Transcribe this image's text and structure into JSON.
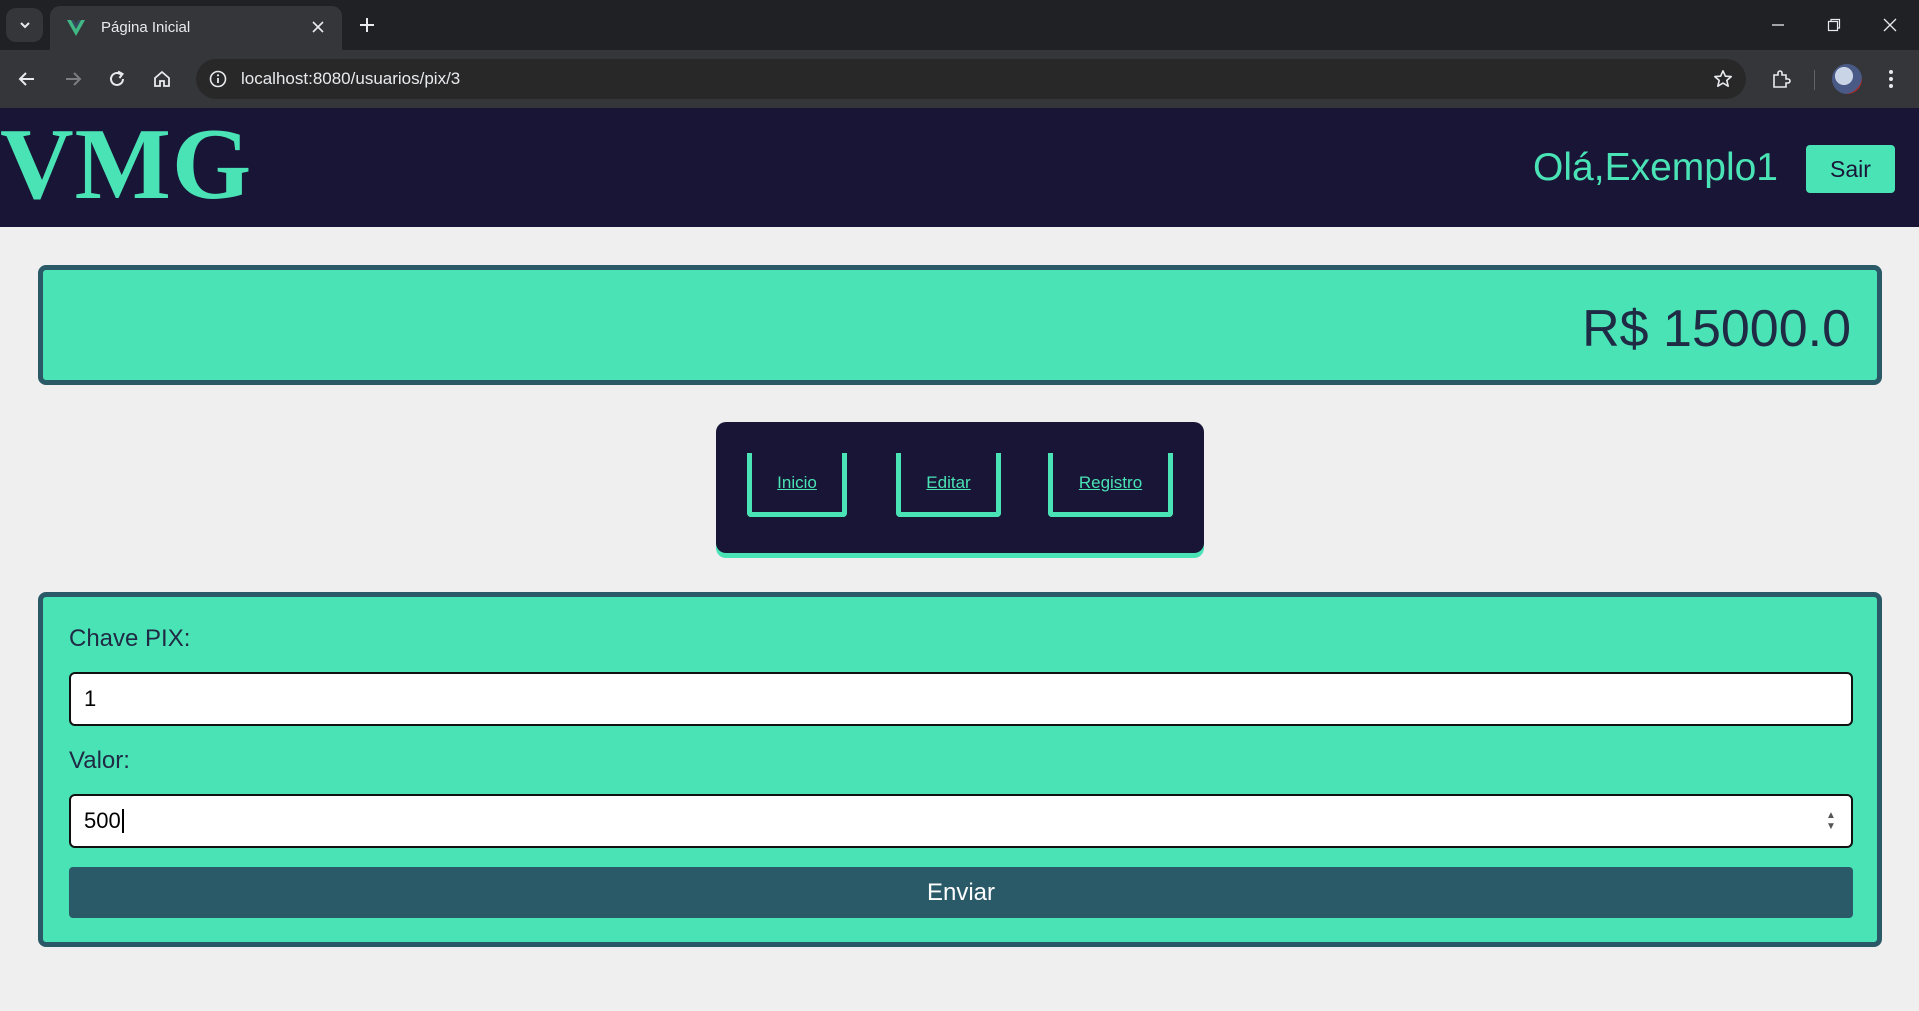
{
  "browser": {
    "tab_title": "Página Inicial",
    "url": "localhost:8080/usuarios/pix/3"
  },
  "header": {
    "logo": "VMG",
    "greeting": "Olá,Exemplo1",
    "logout_label": "Sair"
  },
  "balance": {
    "value": "R$ 15000.0"
  },
  "nav": {
    "links": [
      {
        "label": "Inicio"
      },
      {
        "label": "Editar"
      },
      {
        "label": "Registro"
      }
    ]
  },
  "form": {
    "pix_key_label": "Chave PIX:",
    "pix_key_value": "1",
    "amount_label": "Valor:",
    "amount_value": "500",
    "submit_label": "Enviar"
  },
  "colors": {
    "accent": "#4ae3b5",
    "dark_navy": "#181537",
    "teal_dark": "#2a5a67",
    "page_bg": "#efefef"
  },
  "icons": [
    "tab-search-icon",
    "vue-favicon-icon",
    "close-icon",
    "plus-icon",
    "minimize-icon",
    "restore-icon",
    "window-close-icon",
    "back-icon",
    "forward-icon",
    "reload-icon",
    "home-icon",
    "site-info-icon",
    "star-icon",
    "extensions-icon",
    "more-vert-icon"
  ]
}
